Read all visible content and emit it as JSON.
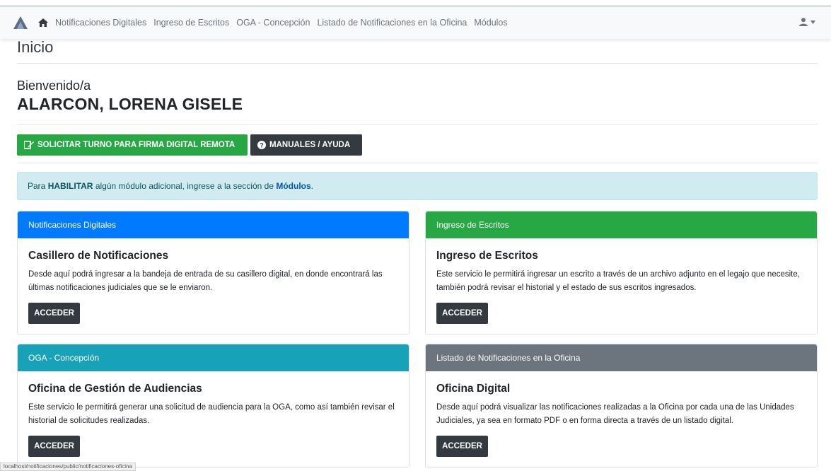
{
  "navbar": {
    "links": [
      "Notificaciones Digitales",
      "Ingreso de Escritos",
      "OGA - Concepción",
      "Listado de Notificaciones en la Oficina",
      "Módulos"
    ]
  },
  "page": {
    "title": "Inicio",
    "welcome": "Bienvenido/a",
    "user_name": "ALARCON, LORENA GISELE"
  },
  "buttons": {
    "turno": "SOLICITAR TURNO PARA FIRMA DIGITAL REMOTA",
    "manuales": "MANUALES / AYUDA"
  },
  "alert": {
    "prefix": "Para ",
    "highlight": "HABILITAR",
    "middle": " algún módulo adicional, ingrese a la sección de ",
    "link": "Módulos",
    "suffix": "."
  },
  "cards": [
    {
      "header": "Notificaciones Digitales",
      "title": "Casillero de Notificaciones",
      "text": "Desde aquí podrá ingresar a la bandeja de entrada de su casillero digital, en donde encontrará las últimas notificaciones judiciales que se le enviaron.",
      "button": "ACCEDER",
      "color": "#007bff"
    },
    {
      "header": "Ingreso de Escritos",
      "title": "Ingreso de Escritos",
      "text": "Este servicio le permitirá ingresar un escrito a través de un archivo adjunto en el legajo que necesite, también podrá revisar el historial y el estado de sus escritos ingresados.",
      "button": "ACCEDER",
      "color": "#28a745"
    },
    {
      "header": "OGA - Concepción",
      "title": "Oficina de Gestión de Audiencias",
      "text": "Este servicio le permitirá generar una solicitud de audiencia para la OGA, como así también revisar el historial de solicitudes realizadas.",
      "button": "ACCEDER",
      "color": "#17a2b8"
    },
    {
      "header": "Listado de Notificaciones en la Oficina",
      "title": "Oficina Digital",
      "text": "Desde aquí podrá visualizar las notificaciones realizadas a la Oficina por cada una de las Unidades Judiciales, ya sea en formato PDF o en forma directa a través de un listado digital.",
      "button": "ACCEDER",
      "color": "#6c757d"
    }
  ],
  "status_bar": {
    "url": "localhost/notificaciones/public/notificaciones-oficina"
  }
}
